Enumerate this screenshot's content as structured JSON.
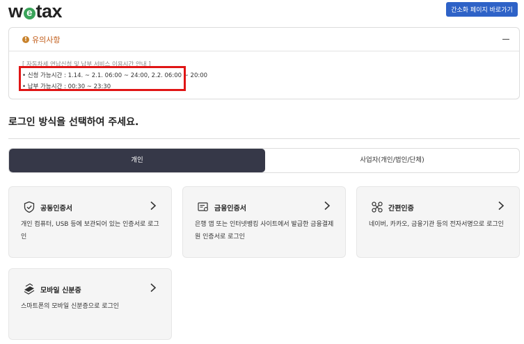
{
  "header": {
    "logo_w": "w",
    "logo_e": "e",
    "logo_rest": "tax",
    "simple_page_button": "간소화 페이지 바로가기"
  },
  "notice": {
    "title": "유의사항",
    "intro": "[ 자동차세 연납신청 및 납부 서비스 이용시간 안내 ]",
    "lines": [
      "• 신청 가능시간 : 1.14. ~ 2.1. 06:00 ~ 24:00, 2.2. 06:00 ~ 20:00",
      "• 납부 가능시간 : 00:30 ~ 23:30"
    ]
  },
  "login": {
    "heading": "로그인 방식을 선택하여 주세요.",
    "tabs": [
      {
        "label": "개인",
        "active": true
      },
      {
        "label": "사업자(개인/법인/단체)",
        "active": false
      }
    ],
    "methods": [
      {
        "title": "공동인증서",
        "icon": "shield-icon",
        "desc": "개인 컴퓨터, USB 등에 보관되어 있는 인증서로 로그인"
      },
      {
        "title": "금융인증서",
        "icon": "certificate-icon",
        "desc": "은행 앱 또는 인터넷뱅킹 사이트에서 발급한 금융결제원 인증서로 로그인"
      },
      {
        "title": "간편인증",
        "icon": "link-nodes-icon",
        "desc": "네이버, 카카오, 금융기관 등의 전자서명으로 로그인"
      },
      {
        "title": "모바일 신분증",
        "icon": "mobile-id-icon",
        "desc": "스마트폰의 모바일 신분증으로 로그인"
      }
    ]
  },
  "colors": {
    "accent_blue": "#2e62c7",
    "active_tab": "#363848",
    "notice_title": "#c05a16",
    "highlight_red": "#e01515",
    "logo_green": "#3aa45a"
  }
}
